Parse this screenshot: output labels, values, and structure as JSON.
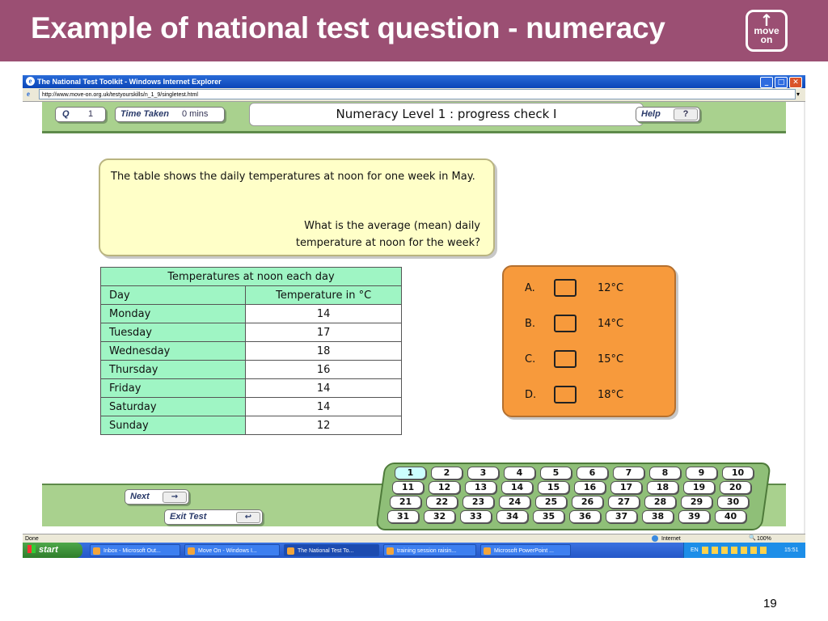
{
  "slide": {
    "title": "Example of national test question - numeracy",
    "logo_text": "move on",
    "page_number": "19"
  },
  "browser": {
    "window_title": "The National Test Toolkit - Windows Internet Explorer",
    "address": "http://www.move-on.org.uk/testyourskills/n_1_9/singletest.html",
    "status_left": "Done",
    "zone": "Internet",
    "zoom": "100%"
  },
  "app": {
    "q_label": "Q",
    "q_value": "1",
    "time_label": "Time Taken",
    "time_value": "0 mins",
    "title": "Numeracy Level 1 : progress check I",
    "help_label": "Help",
    "help_icon": "?",
    "next_label": "Next",
    "exit_label": "Exit Test"
  },
  "question": {
    "intro": "The table shows the daily temperatures at noon for one week in May.",
    "prompt": "What is the average (mean) daily temperature at noon for the week?"
  },
  "table": {
    "caption": "Temperatures at noon each day",
    "col_day": "Day",
    "col_temp": "Temperature in °C",
    "rows": [
      {
        "day": "Monday",
        "temp": "14"
      },
      {
        "day": "Tuesday",
        "temp": "17"
      },
      {
        "day": "Wednesday",
        "temp": "18"
      },
      {
        "day": "Thursday",
        "temp": "16"
      },
      {
        "day": "Friday",
        "temp": "14"
      },
      {
        "day": "Saturday",
        "temp": "14"
      },
      {
        "day": "Sunday",
        "temp": "12"
      }
    ]
  },
  "answers": [
    {
      "letter": "A.",
      "text": "12°C"
    },
    {
      "letter": "B.",
      "text": "14°C"
    },
    {
      "letter": "C.",
      "text": "15°C"
    },
    {
      "letter": "D.",
      "text": "18°C"
    }
  ],
  "question_numbers": [
    "1",
    "2",
    "3",
    "4",
    "5",
    "6",
    "7",
    "8",
    "9",
    "10",
    "11",
    "12",
    "13",
    "14",
    "15",
    "16",
    "17",
    "18",
    "19",
    "20",
    "21",
    "22",
    "23",
    "24",
    "25",
    "26",
    "27",
    "28",
    "29",
    "30",
    "31",
    "32",
    "33",
    "34",
    "35",
    "36",
    "37",
    "38",
    "39",
    "40"
  ],
  "taskbar": {
    "start_label": "start",
    "tasks": [
      "Inbox - Microsoft Out...",
      "Move On - Windows I...",
      "The National Test To...",
      "training session raisin...",
      "Microsoft PowerPoint ..."
    ],
    "lang": "EN",
    "clock": "15:51"
  },
  "colors": {
    "header": "#9b4f73",
    "app_green": "#a9d18e",
    "table_green": "#9ff5c4",
    "answer_orange": "#f79a3c",
    "question_yellow": "#ffffc8"
  }
}
